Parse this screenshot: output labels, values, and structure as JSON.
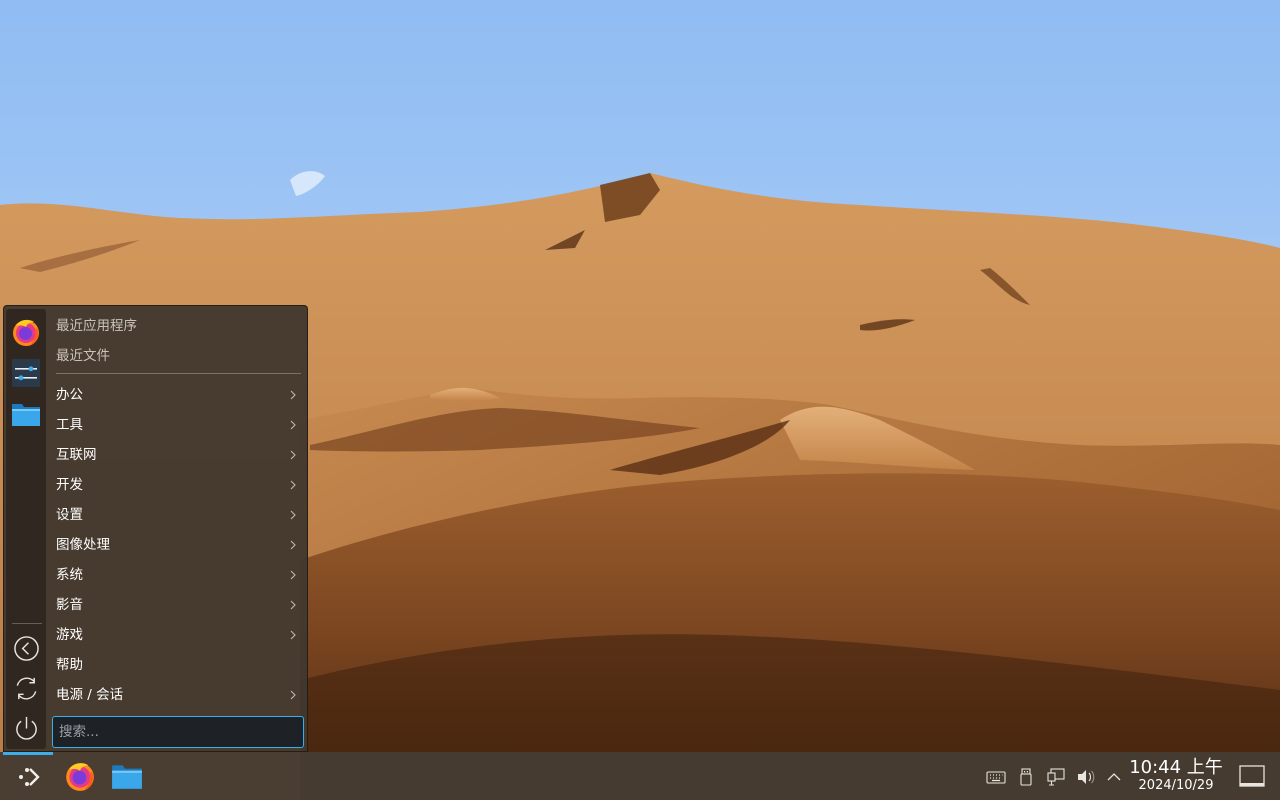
{
  "colors": {
    "sky_top": "#9cc6f5",
    "sand_light": "#d9a066",
    "sand_dark": "#6b3e1c",
    "menu_bg": "#42382e",
    "taskbar_bg": "#463c32",
    "accent": "#3daee9"
  },
  "launcher": {
    "favorites": [
      {
        "name": "firefox",
        "icon": "firefox-icon"
      },
      {
        "name": "system-settings",
        "icon": "settings-sliders-icon"
      },
      {
        "name": "file-manager",
        "icon": "folder-icon"
      }
    ],
    "session_buttons": [
      {
        "name": "lock",
        "icon": "lock-circle-icon"
      },
      {
        "name": "logout",
        "icon": "refresh-circle-icon"
      },
      {
        "name": "shutdown",
        "icon": "power-icon"
      }
    ],
    "recent": [
      "最近应用程序",
      "最近文件"
    ],
    "categories": [
      {
        "label": "办公",
        "submenu": true
      },
      {
        "label": "工具",
        "submenu": true
      },
      {
        "label": "互联网",
        "submenu": true
      },
      {
        "label": "开发",
        "submenu": true
      },
      {
        "label": "设置",
        "submenu": true
      },
      {
        "label": "图像处理",
        "submenu": true
      },
      {
        "label": "系统",
        "submenu": true
      },
      {
        "label": "影音",
        "submenu": true
      },
      {
        "label": "游戏",
        "submenu": true
      },
      {
        "label": "帮助",
        "submenu": false
      },
      {
        "label": "电源 / 会话",
        "submenu": true
      }
    ],
    "search_placeholder": "搜索..."
  },
  "taskbar": {
    "apps": [
      {
        "name": "firefox",
        "icon": "firefox-icon"
      },
      {
        "name": "file-manager",
        "icon": "folder-icon"
      }
    ],
    "tray": [
      {
        "name": "input-method",
        "icon": "keyboard-icon"
      },
      {
        "name": "removable-devices",
        "icon": "usb-icon"
      },
      {
        "name": "network",
        "icon": "network-wired-icon"
      },
      {
        "name": "volume",
        "icon": "speaker-icon"
      },
      {
        "name": "expand-tray",
        "icon": "chevron-up-icon"
      }
    ],
    "clock": {
      "time": "10:44 上午",
      "date": "2024/10/29"
    },
    "show_desktop_icon": "show-desktop-icon"
  }
}
